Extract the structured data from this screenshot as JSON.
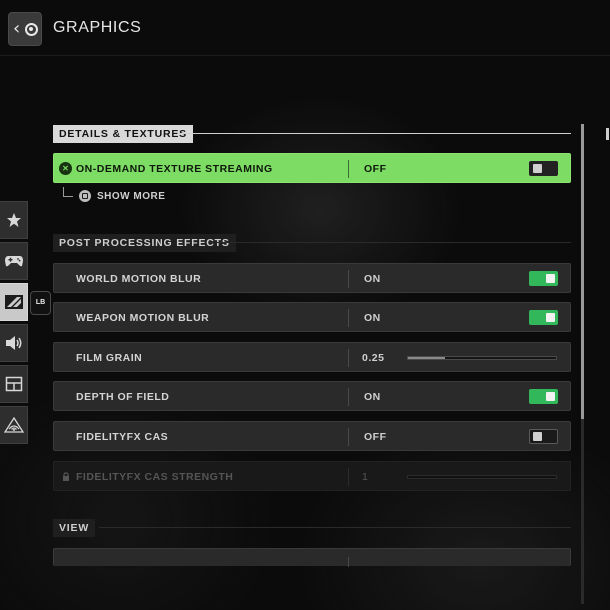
{
  "header": {
    "title": "GRAPHICS",
    "back_icon": "back-chevron-icon"
  },
  "sidenav": {
    "items": [
      {
        "icon": "star-icon"
      },
      {
        "icon": "controller-icon"
      },
      {
        "icon": "graphics-icon",
        "active": true
      },
      {
        "icon": "speaker-icon"
      },
      {
        "icon": "interface-icon"
      },
      {
        "icon": "network-icon"
      }
    ],
    "shoulder_badge": "LB"
  },
  "sections": {
    "details": {
      "label": "DETAILS & TEXTURES",
      "rows": {
        "texture_streaming": {
          "label": "ON-DEMAND TEXTURE STREAMING",
          "value": "OFF",
          "toggle": "off"
        }
      },
      "show_more": "SHOW MORE"
    },
    "post": {
      "label": "POST PROCESSING EFFECTS",
      "rows": {
        "world_motion_blur": {
          "label": "WORLD MOTION BLUR",
          "value": "ON",
          "toggle": "on"
        },
        "weapon_motion_blur": {
          "label": "WEAPON MOTION BLUR",
          "value": "ON",
          "toggle": "on"
        },
        "film_grain": {
          "label": "FILM GRAIN",
          "value": "0.25",
          "slider_fraction": 0.25
        },
        "depth_of_field": {
          "label": "DEPTH OF FIELD",
          "value": "ON",
          "toggle": "on"
        },
        "fidelityfx_cas": {
          "label": "FIDELITYFX CAS",
          "value": "OFF",
          "toggle": "off"
        },
        "fidelityfx_strength": {
          "label": "FIDELITYFX CAS STRENGTH",
          "value": "1",
          "slider_fraction": 0.0,
          "locked": true
        }
      }
    },
    "view": {
      "label": "VIEW"
    }
  },
  "colors": {
    "highlight": "#7ddc63",
    "toggle_on": "#32b85a",
    "row_bg": "#2a2a2a"
  }
}
